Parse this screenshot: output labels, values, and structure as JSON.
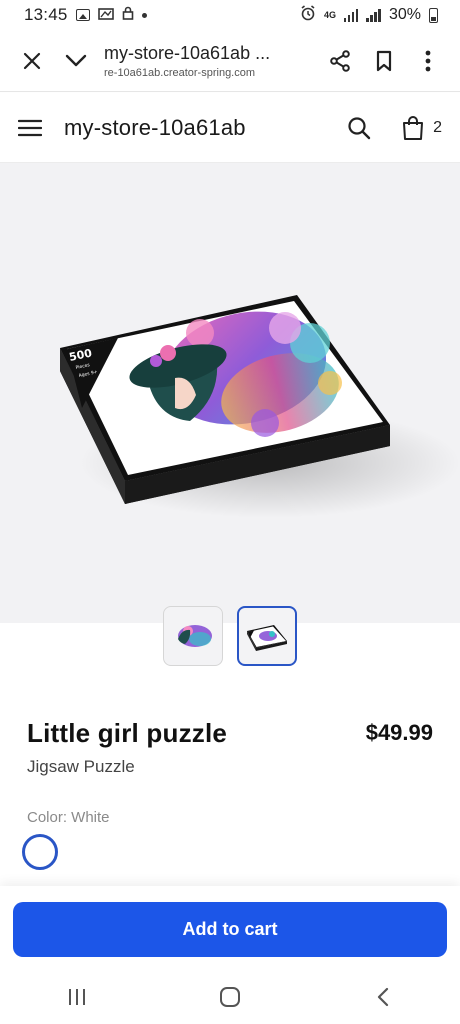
{
  "status_bar": {
    "time": "13:45",
    "network": "4G",
    "battery": "30%"
  },
  "browser": {
    "page_title": "my-store-10a61ab ...",
    "url": "re-10a61ab.creator-spring.com"
  },
  "store": {
    "name": "my-store-10a61ab",
    "cart_count": "2"
  },
  "product": {
    "title": "Little girl puzzle",
    "price": "$49.99",
    "subtitle": "Jigsaw Puzzle",
    "color_label": "Color: White",
    "box_badge": "500",
    "box_badge_sub": "Pieces",
    "box_age": "Ages 9+",
    "thumbnails": [
      {
        "name": "thumb-artwork",
        "active": false
      },
      {
        "name": "thumb-box",
        "active": true
      }
    ]
  },
  "actions": {
    "add_to_cart": "Add to cart"
  },
  "colors": {
    "accent": "#1c56e8",
    "selected_border": "#2a56c6"
  }
}
